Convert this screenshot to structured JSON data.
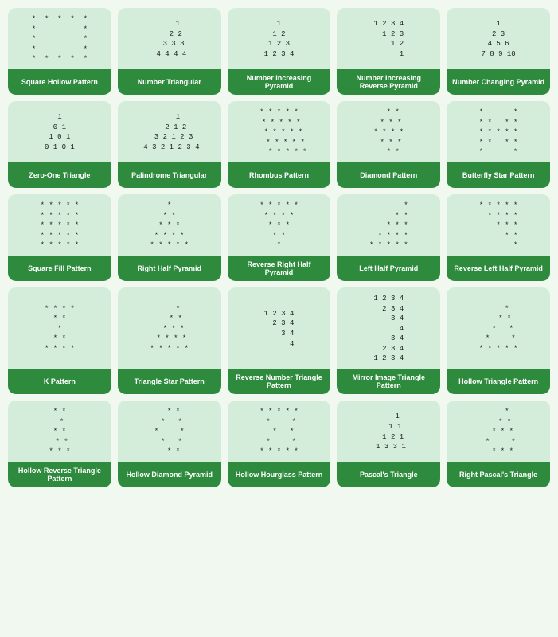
{
  "cards": [
    {
      "id": "square-hollow",
      "label": "Square Hollow Pattern",
      "pattern": "*  *  *  *  *\n*           *\n*           *\n*           *\n*  *  *  *  *"
    },
    {
      "id": "number-triangular",
      "label": "Number Triangular",
      "pattern": "    1\n   2 2\n  3 3 3\n 4 4 4 4"
    },
    {
      "id": "number-increasing-pyramid",
      "label": "Number Increasing Pyramid",
      "pattern": "1\n1 2\n1 2 3\n1 2 3 4"
    },
    {
      "id": "number-increasing-reverse-pyramid",
      "label": "Number Increasing Reverse Pyramid",
      "pattern": "1 2 3 4\n  1 2 3\n    1 2\n      1"
    },
    {
      "id": "number-changing-pyramid",
      "label": "Number Changing Pyramid",
      "pattern": "1\n2 3\n4 5 6\n7 8 9 10"
    },
    {
      "id": "zero-one-triangle",
      "label": "Zero-One Triangle",
      "pattern": "1\n0 1\n1 0 1\n0 1 0 1"
    },
    {
      "id": "palindrome-triangular",
      "label": "Palindrome Triangular",
      "pattern": "    1\n   2 1 2\n  3 2 1 2 3\n 4 3 2 1 2 3 4"
    },
    {
      "id": "rhombus-pattern",
      "label": "Rhombus Pattern",
      "pattern": "* * * * *\n * * * * *\n  * * * * *\n   * * * * *\n    * * * * *"
    },
    {
      "id": "diamond-pattern",
      "label": "Diamond Pattern",
      "pattern": "  * *\n * * *\n* * * *\n * * *\n  * *"
    },
    {
      "id": "butterfly-star",
      "label": "Butterfly Star Pattern",
      "pattern": "*       *\n* *   * *\n* * * * *\n* *   * *\n*       *"
    },
    {
      "id": "square-fill",
      "label": "Square Fill Pattern",
      "pattern": "* * * * *\n* * * * *\n* * * * *\n* * * * *\n* * * * *"
    },
    {
      "id": "right-half-pyramid",
      "label": "Right Half Pyramid",
      "pattern": "*\n* *\n* * *\n* * * *\n* * * * *"
    },
    {
      "id": "reverse-right-half-pyramid",
      "label": "Reverse Right Half Pyramid",
      "pattern": "* * * * *\n* * * *\n* * *\n* *\n*"
    },
    {
      "id": "left-half-pyramid",
      "label": "Left Half Pyramid",
      "pattern": "        *\n      * *\n    * * *\n  * * * *\n* * * * *"
    },
    {
      "id": "reverse-left-half-pyramid",
      "label": "Reverse Left Half Pyramid",
      "pattern": "* * * * *\n  * * * *\n    * * *\n      * *\n        *"
    },
    {
      "id": "k-pattern",
      "label": "K Pattern",
      "pattern": "* * * *\n* *\n*\n* *\n* * * *"
    },
    {
      "id": "triangle-star-pattern",
      "label": "Triangle Star Pattern",
      "pattern": "    *\n   * *\n  * * *\n * * * *\n* * * * *"
    },
    {
      "id": "reverse-number-triangle",
      "label": "Reverse Number Triangle Pattern",
      "pattern": "1 2 3 4\n  2 3 4\n    3 4\n      4"
    },
    {
      "id": "mirror-image-triangle",
      "label": "Mirror Image Triangle Pattern",
      "pattern": "1 2 3 4\n  2 3 4\n    3 4\n      4\n    3 4\n  2 3 4\n1 2 3 4"
    },
    {
      "id": "hollow-triangle-pattern",
      "label": "Hollow Triangle Pattern",
      "pattern": "    *\n   * *\n  *   *\n *     *\n* * * * *"
    },
    {
      "id": "hollow-reverse-triangle",
      "label": "Hollow Reverse Triangle Pattern",
      "pattern": "* *\n *\n* *\n * *\n* * *"
    },
    {
      "id": "hollow-diamond-pyramid",
      "label": "Hollow Diamond Pyramid",
      "pattern": "  * *\n *   *\n*     *\n *   *\n  * *"
    },
    {
      "id": "hollow-hourglass",
      "label": "Hollow Hourglass Pattern",
      "pattern": "* * * * *\n *     *\n  *   *\n *     *\n* * * * *"
    },
    {
      "id": "pascals-triangle",
      "label": "Pascal's Triangle",
      "pattern": "    1\n   1 1\n  1 2 1\n 1 3 3 1"
    },
    {
      "id": "right-pascals-triangle",
      "label": "Right Pascal's Triangle",
      "pattern": "    *\n   * *\n  * * *\n *     *\n  * * *"
    }
  ]
}
